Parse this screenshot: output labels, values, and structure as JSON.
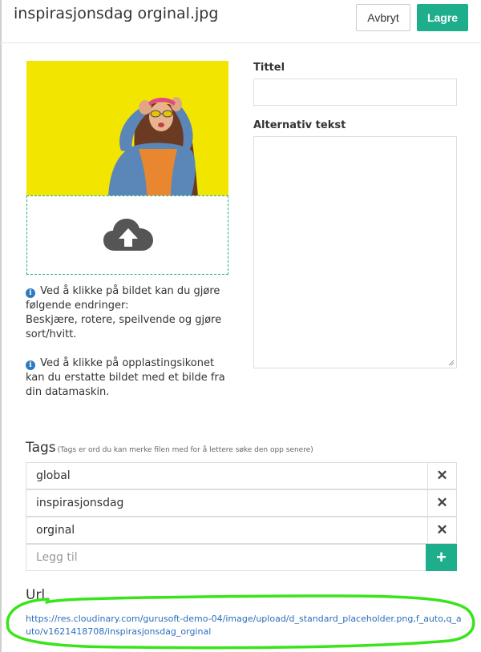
{
  "header": {
    "title": "inspirasjonsdag orginal.jpg",
    "cancel_label": "Avbryt",
    "save_label": "Lagre"
  },
  "info": {
    "line1": "Ved å klikke på bildet kan du gjøre følgende endringer:",
    "line2": "Beskjære, rotere, speilvende og gjøre sort/hvitt.",
    "line3": "Ved å klikke på opplastingsikonet kan du erstatte bildet med et bilde fra din datamaskin."
  },
  "form": {
    "title_label": "Tittel",
    "title_value": "",
    "alt_label": "Alternativ tekst",
    "alt_value": ""
  },
  "tags": {
    "heading": "Tags",
    "hint": "(Tags er ord du kan merke filen med for å lettere søke den opp senere)",
    "items": [
      {
        "label": "global"
      },
      {
        "label": "inspirasjonsdag"
      },
      {
        "label": "orginal"
      }
    ],
    "add_placeholder": "Legg til",
    "add_symbol": "+",
    "remove_symbol": "✕"
  },
  "url": {
    "heading": "Url",
    "href": "https://res.cloudinary.com/gurusoft-demo-04/image/upload/d_standard_placeholder.png,f_auto,q_auto/v1621418708/inspirasjonsdag_orginal"
  },
  "colors": {
    "accent": "#1fae8c",
    "photo_background": "#f2e600",
    "link": "#2a6ebb",
    "info_icon": "#2f7bbf",
    "annotation": "#39e41a"
  },
  "icons": {
    "upload": "cloud-upload-icon",
    "info": "info-circle-icon",
    "remove": "close-icon",
    "add": "plus-icon"
  }
}
